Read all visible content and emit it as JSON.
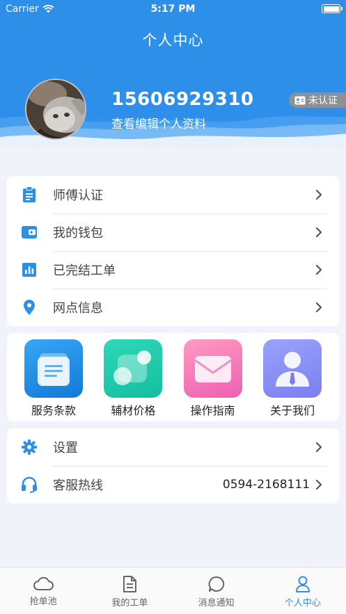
{
  "status_bar": {
    "carrier": "Carrier",
    "time": "5:17 PM"
  },
  "nav": {
    "title": "个人中心"
  },
  "profile": {
    "phone": "15606929310",
    "edit_link": "查看编辑个人资料",
    "badge": "未认证"
  },
  "menu_top": [
    {
      "label": "师傅认证",
      "icon": "clipboard-icon"
    },
    {
      "label": "我的钱包",
      "icon": "wallet-icon"
    },
    {
      "label": "已完结工单",
      "icon": "bar-chart-icon"
    },
    {
      "label": "网点信息",
      "icon": "location-pin-icon"
    }
  ],
  "grid": [
    {
      "label": "服务条款",
      "icon": "document-stack-icon",
      "color": "#1a8fe8"
    },
    {
      "label": "辅材价格",
      "icon": "bubbles-icon",
      "color": "#1ccfa7"
    },
    {
      "label": "操作指南",
      "icon": "envelope-icon",
      "color": "#f26fb2"
    },
    {
      "label": "关于我们",
      "icon": "person-tie-icon",
      "color": "#8a8ef5"
    }
  ],
  "menu_bottom": [
    {
      "label": "设置",
      "icon": "gear-icon"
    },
    {
      "label": "客服热线",
      "icon": "headset-icon",
      "value": "0594-2168111"
    }
  ],
  "tabbar": [
    {
      "label": "抢单池",
      "icon": "cloud-icon",
      "active": false
    },
    {
      "label": "我的工单",
      "icon": "document-icon",
      "active": false
    },
    {
      "label": "消息通知",
      "icon": "chat-bubble-icon",
      "active": false
    },
    {
      "label": "个人中心",
      "icon": "user-icon",
      "active": true
    }
  ],
  "colors": {
    "primary": "#2d8fe8",
    "badge_bg": "#8c9097",
    "page_bg": "#f0f3f9"
  }
}
